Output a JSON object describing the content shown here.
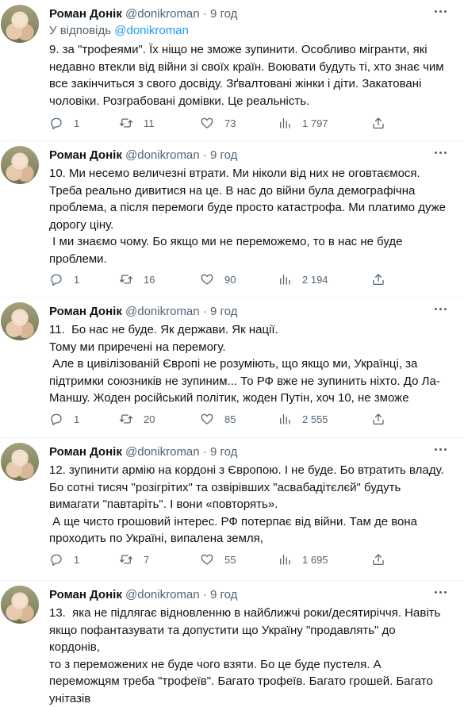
{
  "author": {
    "name": "Роман Донік",
    "handle": "@donikroman",
    "separator": "·"
  },
  "tweets": [
    {
      "time": "9 год",
      "reply_to_prefix": "У відповідь ",
      "reply_to_mention": "@donikroman",
      "lines": [
        "9. за \"трофеями\". Їх ніщо не зможе зупинити. Особливо мігранти, які",
        "недавно втекли від війни зі своїх країн. Воювати будуть ті, хто знає чим",
        "все закінчиться з свого досвіду. Зґвалтовані жінки і діти. Закатовані",
        "чоловіки. Розграбовані домівки. Це реальність."
      ],
      "replies": "1",
      "retweets": "11",
      "likes": "73",
      "views": "1 797"
    },
    {
      "time": "9 год",
      "lines": [
        "10. Ми несемо величезні втрати. Ми ніколи від них не оговтаємося.",
        "Треба реально дивитися на це. В нас до війни була демографічна",
        "проблема, а після перемоги буде просто катастрофа. Ми платимо дуже",
        "дорогу ціну.",
        " І ми знаємо чому. Бо якщо ми не переможемо, то в нас не буде",
        "проблеми."
      ],
      "replies": "1",
      "retweets": "16",
      "likes": "90",
      "views": "2 194"
    },
    {
      "time": "9 год",
      "lines": [
        "11.  Бо нас не буде. Як держави. Як нації.",
        "Тому ми приречені на перемогу.",
        " Але в цивілізованій Європі не розуміють, що якщо ми, Українці, за",
        "підтримки союзників не зупиним... То РФ вже не зупинить ніхто. До Ла-",
        "Маншу. Жоден російський політик, жоден Путін, хоч 10, не зможе"
      ],
      "replies": "1",
      "retweets": "20",
      "likes": "85",
      "views": "2 555"
    },
    {
      "time": "9 год",
      "lines": [
        "12. зупинити армію на кордоні з Європою. І не буде. Бо втратить владу.",
        "Бо сотні тисяч \"розігрітих\" та озвірівших \"асвабадітєлєй\" будуть",
        "вимагати \"павтаріть\". І вони «повторять».",
        " А ще чисто грошовий інтерес. РФ потерпає від війни. Там де вона",
        "проходить по Україні, випалена земля,"
      ],
      "replies": "1",
      "retweets": "7",
      "likes": "55",
      "views": "1 695"
    },
    {
      "time": "9 год",
      "lines": [
        "13.  яка не підлягає відновленню в найближчі роки/десятиріччя. Навіть",
        "якщо пофантазувати та допустити що Україну \"продавлять\" до кордонів,",
        "то з переможених не буде чого взяти. Бо це буде пустеля. А",
        "переможцям треба \"трофеїв\". Багато трофеїв. Багато грошей. Багато",
        "унітазів"
      ]
    }
  ]
}
